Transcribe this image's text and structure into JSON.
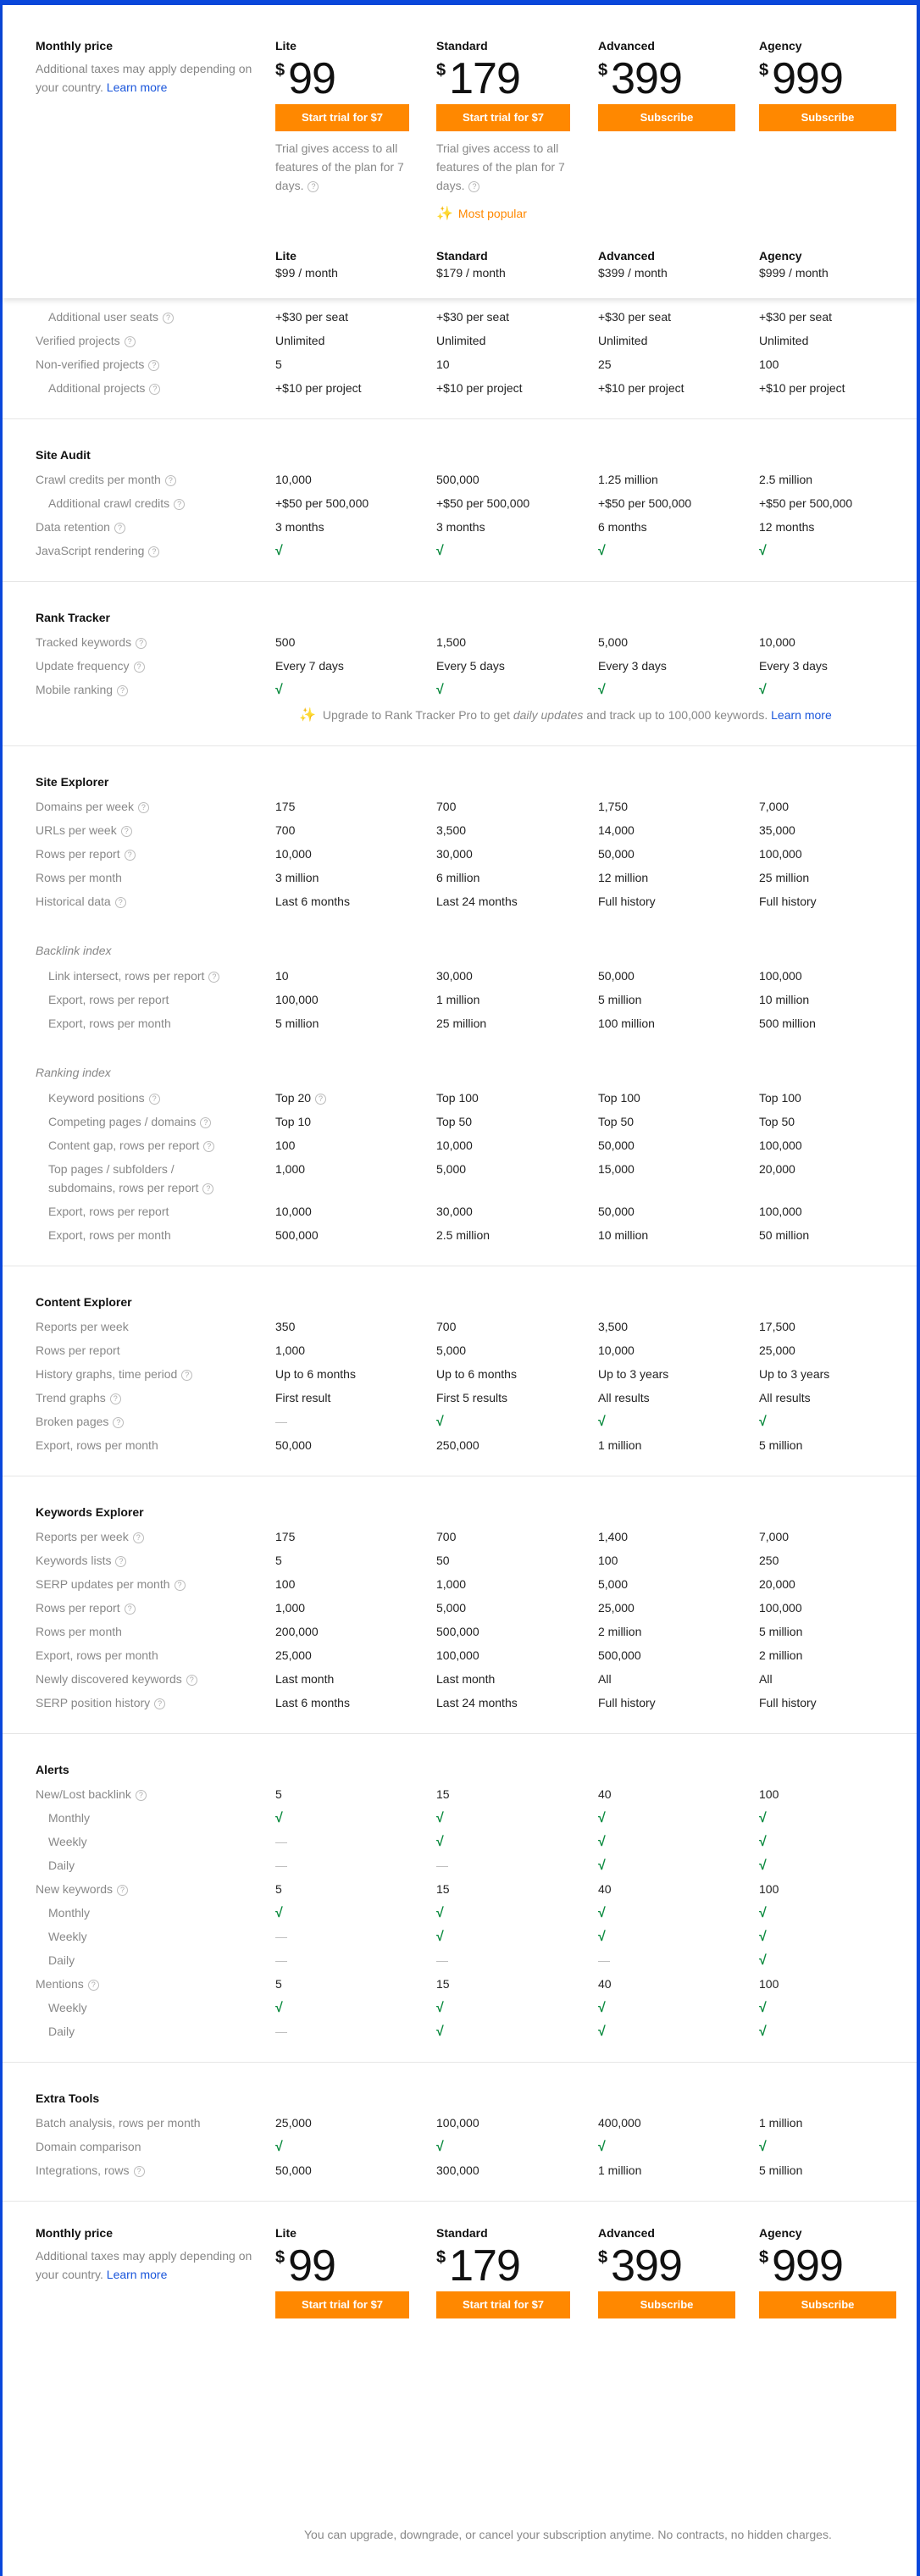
{
  "header": {
    "monthly_price_label": "Monthly price",
    "tax_note": "Additional taxes may apply depending on your country.",
    "learn_more": "Learn more",
    "currency": "$",
    "most_popular": "Most popular",
    "trial_note": "Trial gives access to all features of the plan for 7 days.",
    "plans": [
      {
        "name": "Lite",
        "price": "99",
        "button": "Start trial for $7",
        "per_month": "$99 / month",
        "trial_note": true
      },
      {
        "name": "Standard",
        "price": "179",
        "button": "Start trial for $7",
        "per_month": "$179 / month",
        "trial_note": true,
        "popular": true
      },
      {
        "name": "Advanced",
        "price": "399",
        "button": "Subscribe",
        "per_month": "$399 / month"
      },
      {
        "name": "Agency",
        "price": "999",
        "button": "Subscribe",
        "per_month": "$999 / month"
      }
    ]
  },
  "colors": {
    "accent": "#ff8800",
    "link": "#1a56db",
    "check": "#0a8a3e",
    "frame": "#0a47db"
  },
  "sections": [
    {
      "title": "",
      "rows": [
        {
          "label": "Additional user seats",
          "indent": true,
          "help": true,
          "values": [
            "+$30 per seat",
            "+$30 per seat",
            "+$30 per seat",
            "+$30 per seat"
          ]
        },
        {
          "label": "Verified projects",
          "help": true,
          "values": [
            "Unlimited",
            "Unlimited",
            "Unlimited",
            "Unlimited"
          ]
        },
        {
          "label": "Non-verified projects",
          "help": true,
          "values": [
            "5",
            "10",
            "25",
            "100"
          ]
        },
        {
          "label": "Additional projects",
          "indent": true,
          "help": true,
          "values": [
            "+$10 per project",
            "+$10 per project",
            "+$10 per project",
            "+$10 per project"
          ]
        }
      ]
    },
    {
      "title": "Site Audit",
      "rows": [
        {
          "label": "Crawl credits per month",
          "help": true,
          "values": [
            "10,000",
            "500,000",
            "1.25 million",
            "2.5 million"
          ]
        },
        {
          "label": "Additional crawl credits",
          "indent": true,
          "help": true,
          "values": [
            "+$50 per 500,000",
            "+$50 per 500,000",
            "+$50 per 500,000",
            "+$50 per 500,000"
          ]
        },
        {
          "label": "Data retention",
          "help": true,
          "values": [
            "3 months",
            "3 months",
            "6 months",
            "12 months"
          ]
        },
        {
          "label": "JavaScript rendering",
          "help": true,
          "values": [
            "check",
            "check",
            "check",
            "check"
          ]
        }
      ]
    },
    {
      "title": "Rank Tracker",
      "rows": [
        {
          "label": "Tracked keywords",
          "help": true,
          "values": [
            "500",
            "1,500",
            "5,000",
            "10,000"
          ]
        },
        {
          "label": "Update frequency",
          "help": true,
          "values": [
            "Every 7 days",
            "Every 5 days",
            "Every 3 days",
            "Every 3 days"
          ]
        },
        {
          "label": "Mobile ranking",
          "help": true,
          "values": [
            "check",
            "check",
            "check",
            "check"
          ]
        }
      ],
      "upgrade": {
        "prefix": "Upgrade to Rank Tracker Pro to get ",
        "em": "daily updates",
        "suffix": " and track up to 100,000 keywords.",
        "link": "Learn more"
      }
    },
    {
      "title": "Site Explorer",
      "rows": [
        {
          "label": "Domains per week",
          "help": true,
          "values": [
            "175",
            "700",
            "1,750",
            "7,000"
          ]
        },
        {
          "label": "URLs per week",
          "help": true,
          "values": [
            "700",
            "3,500",
            "14,000",
            "35,000"
          ]
        },
        {
          "label": "Rows per report",
          "help": true,
          "values": [
            "10,000",
            "30,000",
            "50,000",
            "100,000"
          ]
        },
        {
          "label": "Rows per month",
          "values": [
            "3 million",
            "6 million",
            "12 million",
            "25 million"
          ]
        },
        {
          "label": "Historical data",
          "help": true,
          "values": [
            "Last 6 months",
            "Last 24 months",
            "Full history",
            "Full history"
          ]
        }
      ],
      "subgroups": [
        {
          "title": "Backlink index",
          "rows": [
            {
              "label": "Link intersect, rows per report",
              "indent": true,
              "help": true,
              "values": [
                "10",
                "30,000",
                "50,000",
                "100,000"
              ]
            },
            {
              "label": "Export, rows per report",
              "indent": true,
              "values": [
                "100,000",
                "1 million",
                "5 million",
                "10 million"
              ]
            },
            {
              "label": "Export, rows per month",
              "indent": true,
              "values": [
                "5 million",
                "25 million",
                "100 million",
                "500 million"
              ]
            }
          ]
        },
        {
          "title": "Ranking index",
          "rows": [
            {
              "label": "Keyword positions",
              "indent": true,
              "help": true,
              "values": [
                "Top 20",
                "Top 100",
                "Top 100",
                "Top 100"
              ],
              "value_help": [
                true,
                false,
                false,
                false
              ]
            },
            {
              "label": "Competing pages / domains",
              "indent": true,
              "help": true,
              "values": [
                "Top 10",
                "Top 50",
                "Top 50",
                "Top 50"
              ]
            },
            {
              "label": "Content gap, rows per report",
              "indent": true,
              "help": true,
              "values": [
                "100",
                "10,000",
                "50,000",
                "100,000"
              ]
            },
            {
              "label": "Top pages / subfolders / subdomains, rows per report",
              "indent": true,
              "help": true,
              "values": [
                "1,000",
                "5,000",
                "15,000",
                "20,000"
              ],
              "tall": true
            },
            {
              "label": "Export, rows per report",
              "indent": true,
              "values": [
                "10,000",
                "30,000",
                "50,000",
                "100,000"
              ]
            },
            {
              "label": "Export, rows per month",
              "indent": true,
              "values": [
                "500,000",
                "2.5 million",
                "10 million",
                "50 million"
              ]
            }
          ]
        }
      ]
    },
    {
      "title": "Content Explorer",
      "rows": [
        {
          "label": "Reports per week",
          "values": [
            "350",
            "700",
            "3,500",
            "17,500"
          ]
        },
        {
          "label": "Rows per report",
          "values": [
            "1,000",
            "5,000",
            "10,000",
            "25,000"
          ]
        },
        {
          "label": "History graphs, time period",
          "help": true,
          "values": [
            "Up to 6 months",
            "Up to 6 months",
            "Up to 3 years",
            "Up to 3 years"
          ]
        },
        {
          "label": "Trend graphs",
          "help": true,
          "values": [
            "First result",
            "First 5 results",
            "All results",
            "All results"
          ]
        },
        {
          "label": "Broken pages",
          "help": true,
          "values": [
            "dash",
            "check",
            "check",
            "check"
          ]
        },
        {
          "label": "Export, rows per month",
          "values": [
            "50,000",
            "250,000",
            "1 million",
            "5 million"
          ]
        }
      ]
    },
    {
      "title": "Keywords Explorer",
      "rows": [
        {
          "label": "Reports per week",
          "help": true,
          "values": [
            "175",
            "700",
            "1,400",
            "7,000"
          ]
        },
        {
          "label": "Keywords lists",
          "help": true,
          "values": [
            "5",
            "50",
            "100",
            "250"
          ]
        },
        {
          "label": "SERP updates per month",
          "help": true,
          "values": [
            "100",
            "1,000",
            "5,000",
            "20,000"
          ]
        },
        {
          "label": "Rows per report",
          "help": true,
          "values": [
            "1,000",
            "5,000",
            "25,000",
            "100,000"
          ]
        },
        {
          "label": "Rows per month",
          "values": [
            "200,000",
            "500,000",
            "2 million",
            "5 million"
          ]
        },
        {
          "label": "Export, rows per month",
          "values": [
            "25,000",
            "100,000",
            "500,000",
            "2 million"
          ]
        },
        {
          "label": "Newly discovered keywords",
          "help": true,
          "values": [
            "Last month",
            "Last month",
            "All",
            "All"
          ]
        },
        {
          "label": "SERP position history",
          "help": true,
          "values": [
            "Last 6 months",
            "Last 24 months",
            "Full history",
            "Full history"
          ]
        }
      ]
    },
    {
      "title": "Alerts",
      "rows": [
        {
          "label": "New/Lost backlink",
          "help": true,
          "values": [
            "5",
            "15",
            "40",
            "100"
          ]
        },
        {
          "label": "Monthly",
          "indent": true,
          "values": [
            "check",
            "check",
            "check",
            "check"
          ]
        },
        {
          "label": "Weekly",
          "indent": true,
          "values": [
            "dash",
            "check",
            "check",
            "check"
          ]
        },
        {
          "label": "Daily",
          "indent": true,
          "values": [
            "dash",
            "dash",
            "check",
            "check"
          ]
        },
        {
          "label": "New keywords",
          "help": true,
          "values": [
            "5",
            "15",
            "40",
            "100"
          ]
        },
        {
          "label": "Monthly",
          "indent": true,
          "values": [
            "check",
            "check",
            "check",
            "check"
          ]
        },
        {
          "label": "Weekly",
          "indent": true,
          "values": [
            "dash",
            "check",
            "check",
            "check"
          ]
        },
        {
          "label": "Daily",
          "indent": true,
          "values": [
            "dash",
            "dash",
            "dash",
            "check"
          ]
        },
        {
          "label": "Mentions",
          "help": true,
          "values": [
            "5",
            "15",
            "40",
            "100"
          ]
        },
        {
          "label": "Weekly",
          "indent": true,
          "values": [
            "check",
            "check",
            "check",
            "check"
          ]
        },
        {
          "label": "Daily",
          "indent": true,
          "values": [
            "dash",
            "check",
            "check",
            "check"
          ]
        }
      ]
    },
    {
      "title": "Extra Tools",
      "rows": [
        {
          "label": "Batch analysis, rows per month",
          "values": [
            "25,000",
            "100,000",
            "400,000",
            "1 million"
          ]
        },
        {
          "label": "Domain comparison",
          "values": [
            "check",
            "check",
            "check",
            "check"
          ]
        },
        {
          "label": "Integrations, rows",
          "help": true,
          "values": [
            "50,000",
            "300,000",
            "1 million",
            "5 million"
          ]
        }
      ]
    }
  ],
  "footer": {
    "note": "You can upgrade, downgrade, or cancel your subscription anytime. No contracts, no hidden charges."
  },
  "icons": {
    "help": "?",
    "check": "√",
    "dash": "—",
    "sparkle": "✨"
  }
}
